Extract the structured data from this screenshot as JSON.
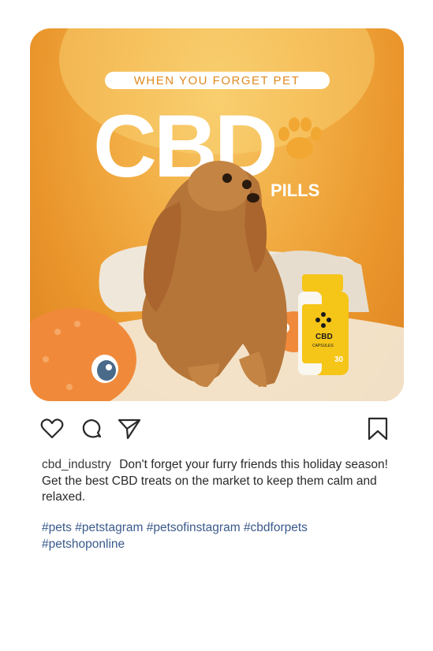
{
  "post": {
    "image": {
      "headline": "WHEN YOU FORGET PET",
      "brand": "CBD",
      "subtitle": "PILLS",
      "bottle_label": "CBD",
      "bottle_sublabel": "CAPSULES",
      "bottle_count": "30",
      "background_color": "#f2ae45",
      "accent_color": "#f5c518"
    },
    "actions": {
      "like_icon": "heart-icon",
      "comment_icon": "comment-icon",
      "share_icon": "send-icon",
      "save_icon": "bookmark-icon"
    },
    "caption": {
      "username": "cbd_industry",
      "text": "Don't forget your furry friends this holiday season! Get the best CBD treats on the market to keep them calm and relaxed."
    },
    "hashtags": [
      "#pets",
      "#petstagram",
      "#petsofinstagram",
      "#cbdforpets",
      "#petshoponline"
    ]
  }
}
